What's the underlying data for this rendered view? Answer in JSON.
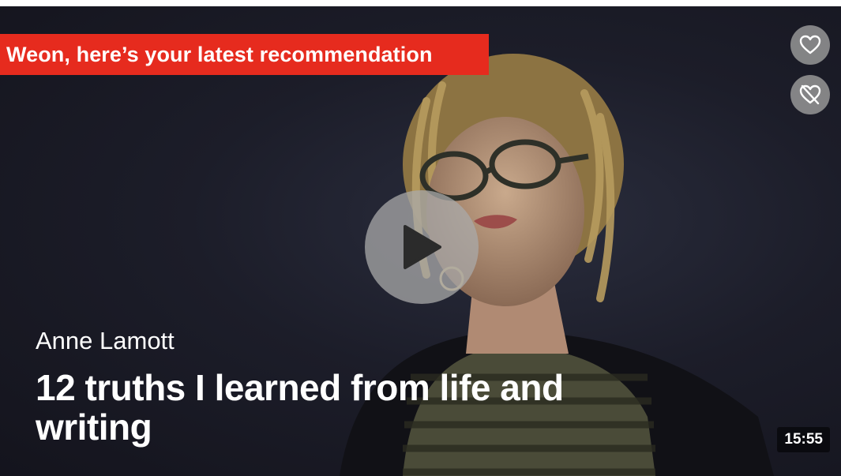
{
  "banner": {
    "text": "Weon, here’s your latest recommendation"
  },
  "talk": {
    "speaker": "Anne Lamott",
    "title": "12 truths I learned from life and writing",
    "duration": "15:55"
  },
  "icons": {
    "like": "heart-icon",
    "dislike": "heart-crossed-icon",
    "play": "play-icon"
  },
  "colors": {
    "accent": "#e62b1e",
    "background": "#1c1d29"
  }
}
